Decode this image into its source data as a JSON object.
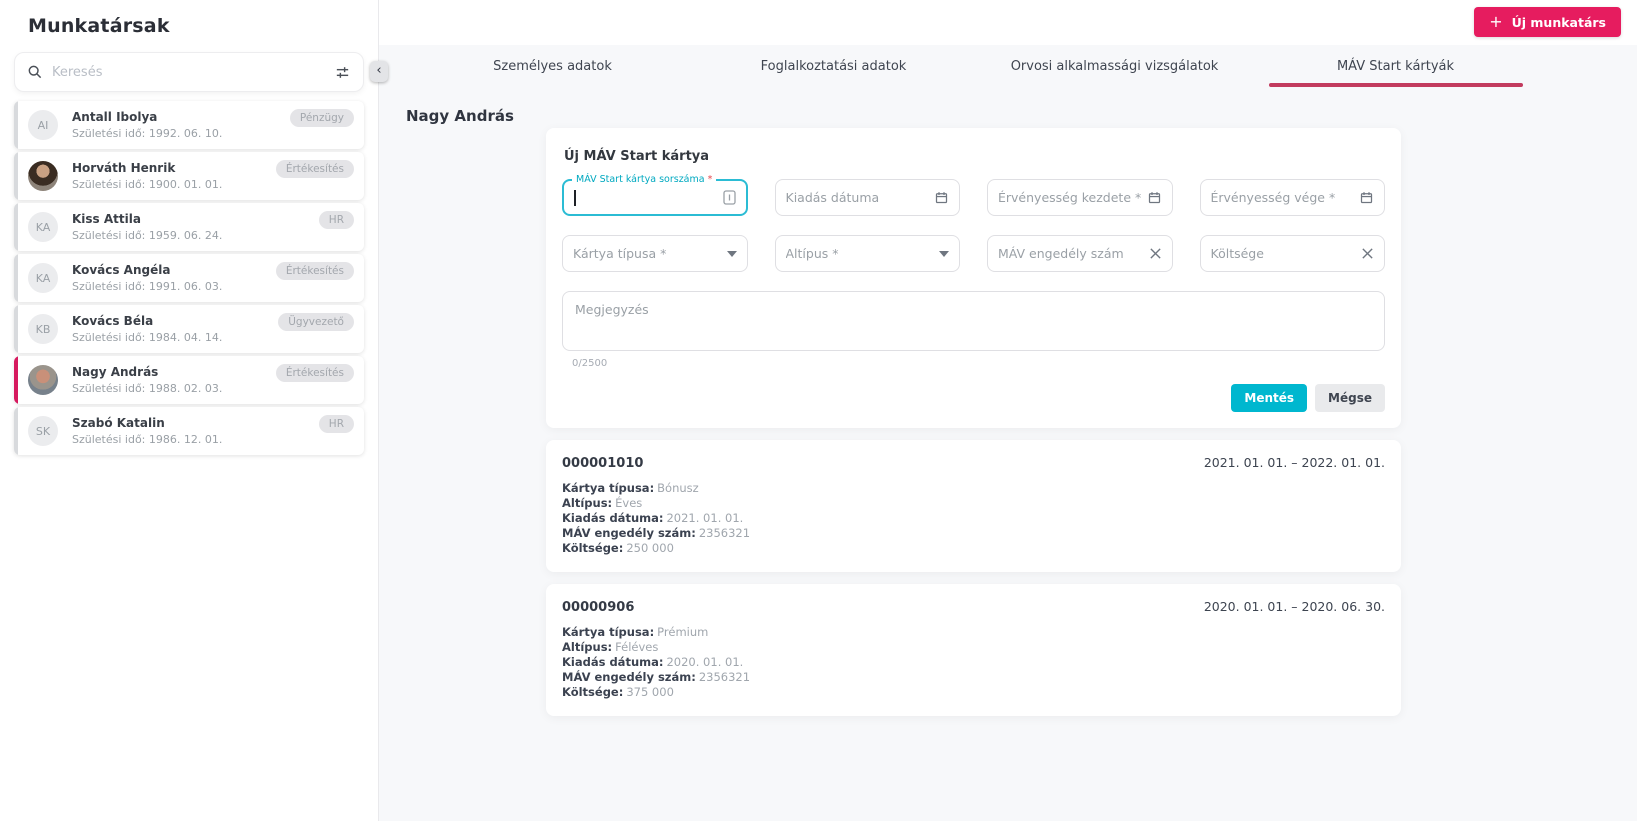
{
  "colors": {
    "accent_pink": "#e61c5f",
    "selected_item_bar": "#d6195e",
    "tab_underline": "#c23b5e",
    "accent_teal": "#00b7cf",
    "focus_border": "#2bbcd4"
  },
  "sidebar": {
    "title": "Munkatársak",
    "search": {
      "placeholder": "Keresés"
    },
    "employees": [
      {
        "initials": "AI",
        "name": "Antall Ibolya",
        "birth": "Születési idő: 1992. 06. 10.",
        "badge": "Pénzügy",
        "photo": "",
        "selected": false
      },
      {
        "initials": "",
        "name": "Horváth Henrik",
        "birth": "Születési idő: 1900. 01. 01.",
        "badge": "Értékesítés",
        "photo": "photo-a",
        "selected": false
      },
      {
        "initials": "KA",
        "name": "Kiss Attila",
        "birth": "Születési idő: 1959. 06. 24.",
        "badge": "HR",
        "photo": "",
        "selected": false
      },
      {
        "initials": "KA",
        "name": "Kovács Angéla",
        "birth": "Születési idő: 1991. 06. 03.",
        "badge": "Értékesítés",
        "photo": "",
        "selected": false
      },
      {
        "initials": "KB",
        "name": "Kovács Béla",
        "birth": "Születési idő: 1984. 04. 14.",
        "badge": "Ügyvezető",
        "photo": "",
        "selected": false
      },
      {
        "initials": "",
        "name": "Nagy András",
        "birth": "Születési idő: 1988. 02. 03.",
        "badge": "Értékesítés",
        "photo": "photo-b",
        "selected": true
      },
      {
        "initials": "SK",
        "name": "Szabó Katalin",
        "birth": "Születési idő: 1986. 12. 01.",
        "badge": "HR",
        "photo": "",
        "selected": false
      }
    ]
  },
  "header": {
    "new_employee_button": "Új munkatárs"
  },
  "tabs": [
    {
      "label": "Személyes adatok",
      "active": false
    },
    {
      "label": "Foglalkoztatási adatok",
      "active": false
    },
    {
      "label": "Orvosi alkalmassági vizsgálatok",
      "active": false
    },
    {
      "label": "MÁV Start kártyák",
      "active": true
    }
  ],
  "main": {
    "employee_name": "Nagy András",
    "form": {
      "title": "Új MÁV Start kártya",
      "fields": {
        "serial": {
          "label": "MÁV Start kártya sorszáma",
          "required_mark": "*",
          "value": ""
        },
        "issue_date": {
          "placeholder": "Kiadás dátuma"
        },
        "valid_from": {
          "placeholder": "Érvényesség kezdete *"
        },
        "valid_to": {
          "placeholder": "Érvényesség vége *"
        },
        "card_type": {
          "placeholder": "Kártya típusa *"
        },
        "subtype": {
          "placeholder": "Altípus *"
        },
        "mav_permit": {
          "placeholder": "MÁV engedély szám"
        },
        "cost": {
          "placeholder": "Költsége"
        },
        "note": {
          "placeholder": "Megjegyzés",
          "counter": "0/2500"
        }
      },
      "save_label": "Mentés",
      "cancel_label": "Mégse"
    },
    "cards": [
      {
        "number": "000001010",
        "validity": "2021. 01. 01. – 2022. 01. 01.",
        "rows": [
          {
            "label": "Kártya típusa:",
            "value": "Bónusz"
          },
          {
            "label": "Altípus:",
            "value": "Éves"
          },
          {
            "label": "Kiadás dátuma:",
            "value": "2021. 01. 01."
          },
          {
            "label": "MÁV engedély szám:",
            "value": "2356321"
          },
          {
            "label": "Költsége:",
            "value": "250 000"
          }
        ]
      },
      {
        "number": "00000906",
        "validity": "2020. 01. 01. – 2020. 06. 30.",
        "rows": [
          {
            "label": "Kártya típusa:",
            "value": "Prémium"
          },
          {
            "label": "Altípus:",
            "value": "Féléves"
          },
          {
            "label": "Kiadás dátuma:",
            "value": "2020. 01. 01."
          },
          {
            "label": "MÁV engedély szám:",
            "value": "2356321"
          },
          {
            "label": "Költsége:",
            "value": "375 000"
          }
        ]
      }
    ]
  }
}
